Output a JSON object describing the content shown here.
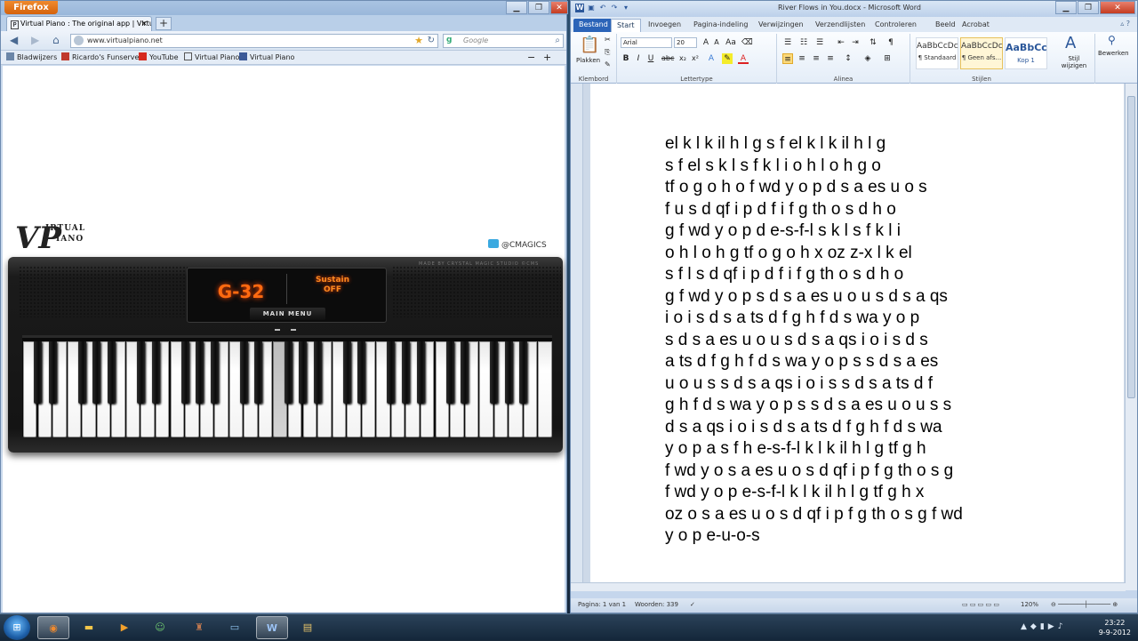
{
  "firefox": {
    "menu_button": "Firefox",
    "tab_title": "Virtual Piano : The original app | Virtual ...",
    "new_tab": "+",
    "url": "www.virtualpiano.net",
    "search_placeholder": "Google",
    "bookmarks": [
      {
        "label": "Bladwijzers",
        "icon": "bookmarks-icon"
      },
      {
        "label": "Ricardo's Funserver",
        "icon": "site-icon"
      },
      {
        "label": "YouTube",
        "icon": "youtube-icon"
      },
      {
        "label": "Virtual Piano",
        "icon": "piano-icon"
      },
      {
        "label": "Virtual Piano",
        "icon": "facebook-icon"
      }
    ]
  },
  "piano": {
    "logo_top": "IRTUAL",
    "logo_bottom": "IANO",
    "twitter": "@CMAGICS",
    "display_note": "G-32",
    "sustain_label": "Sustain",
    "sustain_state": "OFF",
    "main_menu": "MAIN MENU",
    "made_by": "MADE BY CRYSTAL MAGIC STUDIO ©CMS"
  },
  "word": {
    "window_title": "River Flows in You.docx - Microsoft Word",
    "tabs": [
      "Bestand",
      "Start",
      "Invoegen",
      "Pagina-indeling",
      "Verwijzingen",
      "Verzendlijsten",
      "Controleren",
      "Beeld",
      "Acrobat"
    ],
    "font_name": "Arial",
    "font_size": "20",
    "paste_label": "Plakken",
    "styles": [
      {
        "preview": "AaBbCcDc",
        "name": "¶ Standaard"
      },
      {
        "preview": "AaBbCcDc",
        "name": "¶ Geen afs..."
      },
      {
        "preview": "AaBbCc",
        "name": "Kop 1"
      }
    ],
    "change_styles": "Stijl wijzigen",
    "edit_label": "Bewerken",
    "groups": [
      "Klembord",
      "Lettertype",
      "Alinea",
      "Stijlen"
    ],
    "document_lines": [
      "el k l k il h l g s f el k l k il h l g",
      "s f el s k l s f k l i o h l o h g o",
      "tf o g o h o f wd y o p d s a es u o s",
      "f u s d qf i p d f i f g th o s d h o",
      "g f wd y o p d e-s-f-l s k l s f k l i",
      "o h l o h g tf o g o h x oz z-x l k el",
      "s f l s d qf i p d f i f g th o s d h o",
      "g f wd y o p s d s a es u o u s d s a qs",
      "i o i s d s a ts d f g h f d s wa y o p",
      "s d s a es u o u s d s a qs i o i s d s",
      "a ts d f g h f d s wa y o p s s d s a es",
      "u o u s s d s a qs i o i s s d s a ts d f",
      "g h f d s wa y o p s s d s a es u o u s s",
      "d s a qs i o i s d s a ts d f g h f d s wa",
      "y o p a s f h e-s-f-l k l k il h l g tf g h",
      "f wd y o s a es u o s d qf i p f g th o s g",
      "f wd y o p e-s-f-l k l k il h l g tf g h x",
      "oz o s a es u o s d qf i p f g th o s g f wd",
      "y o p e-u-o-s"
    ],
    "status_page": "Pagina: 1 van 1",
    "status_words": "Woorden: 339",
    "zoom": "120%"
  },
  "taskbar": {
    "time": "23:22",
    "date": "9-9-2012",
    "apps": [
      "firefox-icon",
      "explorer-icon",
      "media-player-icon",
      "messenger-icon",
      "game-icon",
      "screen-icon",
      "word-icon",
      "recorder-icon"
    ]
  }
}
